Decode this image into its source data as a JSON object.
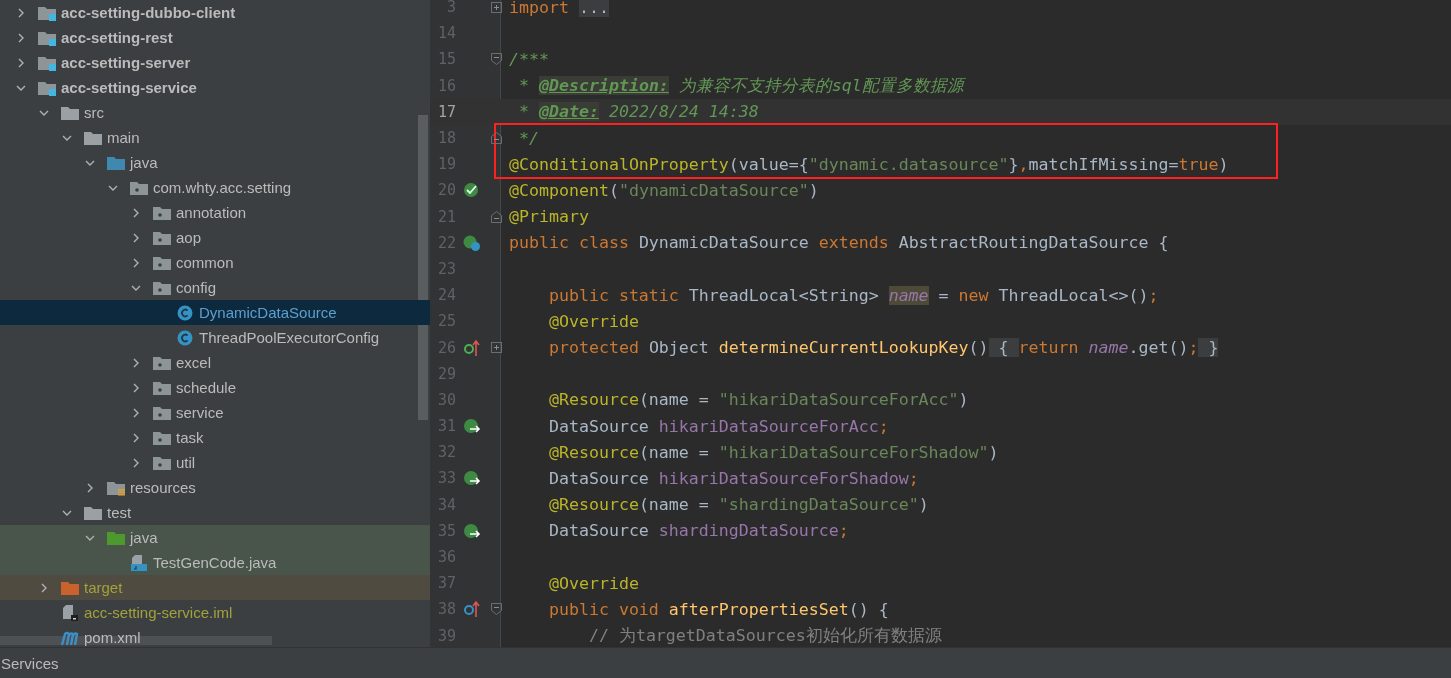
{
  "project_tree": {
    "items": [
      {
        "label": "acc-setting-dubbo-client",
        "kind": "module",
        "expanded": false,
        "selected": false
      },
      {
        "label": "acc-setting-rest",
        "kind": "module",
        "expanded": false,
        "selected": false
      },
      {
        "label": "acc-setting-server",
        "kind": "module",
        "expanded": false,
        "selected": false
      },
      {
        "label": "acc-setting-service",
        "kind": "module",
        "expanded": true,
        "selected": false,
        "children": [
          {
            "label": "src",
            "kind": "folder",
            "expanded": true,
            "selected": false,
            "children": [
              {
                "label": "main",
                "kind": "folder",
                "expanded": true,
                "selected": false,
                "children": [
                  {
                    "label": "java",
                    "kind": "source-root",
                    "expanded": true,
                    "selected": false,
                    "children": [
                      {
                        "label": "com.whty.acc.setting",
                        "kind": "package",
                        "expanded": true,
                        "selected": false,
                        "children": [
                          {
                            "label": "annotation",
                            "kind": "package",
                            "expanded": false,
                            "selected": false
                          },
                          {
                            "label": "aop",
                            "kind": "package",
                            "expanded": false,
                            "selected": false
                          },
                          {
                            "label": "common",
                            "kind": "package",
                            "expanded": false,
                            "selected": false
                          },
                          {
                            "label": "config",
                            "kind": "package",
                            "expanded": true,
                            "selected": false,
                            "children": [
                              {
                                "label": "DynamicDataSource",
                                "kind": "class",
                                "selected": true
                              },
                              {
                                "label": "ThreadPoolExecutorConfig",
                                "kind": "class",
                                "selected": false
                              }
                            ]
                          },
                          {
                            "label": "excel",
                            "kind": "package",
                            "expanded": false,
                            "selected": false
                          },
                          {
                            "label": "schedule",
                            "kind": "package",
                            "expanded": false,
                            "selected": false
                          },
                          {
                            "label": "service",
                            "kind": "package",
                            "expanded": false,
                            "selected": false
                          },
                          {
                            "label": "task",
                            "kind": "package",
                            "expanded": false,
                            "selected": false
                          },
                          {
                            "label": "util",
                            "kind": "package",
                            "expanded": false,
                            "selected": false
                          }
                        ]
                      }
                    ]
                  },
                  {
                    "label": "resources",
                    "kind": "resources-root",
                    "expanded": false,
                    "selected": false
                  }
                ]
              },
              {
                "label": "test",
                "kind": "folder",
                "expanded": true,
                "selected": false,
                "children": [
                  {
                    "label": "java",
                    "kind": "test-root",
                    "expanded": true,
                    "selected": false,
                    "children": [
                      {
                        "label": "TestGenCode.java",
                        "kind": "java-file",
                        "selected": false
                      }
                    ]
                  }
                ]
              }
            ]
          },
          {
            "label": "target",
            "kind": "excluded",
            "expanded": false,
            "selected": false
          },
          {
            "label": "acc-setting-service.iml",
            "kind": "iml",
            "selected": false
          },
          {
            "label": "pom.xml",
            "kind": "maven",
            "selected": false
          }
        ]
      }
    ]
  },
  "editor": {
    "lines": [
      {
        "number": "3",
        "current": false,
        "boxed": false,
        "fold_marker": {
          "kind": "collapsed"
        },
        "tokens": [
          {
            "text": "import ",
            "kind": "keyword"
          },
          {
            "text": "...",
            "kind": "folded"
          }
        ]
      },
      {
        "number": "14",
        "current": false,
        "boxed": false
      },
      {
        "number": "15",
        "current": false,
        "boxed": false,
        "fold_marker": {
          "kind": "start"
        },
        "tokens": [
          {
            "text": "/***",
            "kind": "doc"
          }
        ]
      },
      {
        "number": "16",
        "current": false,
        "boxed": false,
        "tokens": [
          {
            "text": " * ",
            "kind": "doc"
          },
          {
            "text": "@Description:",
            "kind": "doctag"
          },
          {
            "text": " 为兼容不支持分表的sql配置多数据源",
            "kind": "doc"
          }
        ]
      },
      {
        "number": "17",
        "current": true,
        "boxed": false,
        "tokens": [
          {
            "text": " * ",
            "kind": "doc"
          },
          {
            "text": "@Date:",
            "kind": "doctag"
          },
          {
            "text": " 2022/8/24 14:38",
            "kind": "doc"
          }
        ]
      },
      {
        "number": "18",
        "current": false,
        "boxed": true,
        "fold_marker": {
          "kind": "end"
        },
        "tokens": [
          {
            "text": " */",
            "kind": "doc"
          }
        ]
      },
      {
        "number": "19",
        "current": false,
        "boxed": true,
        "tokens": [
          {
            "text": "@ConditionalOnProperty",
            "kind": "annotation"
          },
          {
            "text": "(value={",
            "kind": "plain"
          },
          {
            "text": "\"dynamic.datasource\"",
            "kind": "string"
          },
          {
            "text": "}",
            "kind": "plain"
          },
          {
            "text": ",",
            "kind": "keyword"
          },
          {
            "text": "matchIfMissing=",
            "kind": "plain"
          },
          {
            "text": "true",
            "kind": "keyword"
          },
          {
            "text": ")",
            "kind": "plain"
          }
        ]
      },
      {
        "number": "20",
        "current": false,
        "boxed": false,
        "gutter_icon": {
          "kind": "bean"
        },
        "tokens": [
          {
            "text": "@Component",
            "kind": "annotation"
          },
          {
            "text": "(",
            "kind": "plain"
          },
          {
            "text": "\"dynamicDataSource\"",
            "kind": "string"
          },
          {
            "text": ")",
            "kind": "plain"
          }
        ]
      },
      {
        "number": "21",
        "current": false,
        "boxed": false,
        "fold_marker": {
          "kind": "end"
        },
        "tokens": [
          {
            "text": "@Primary",
            "kind": "annotation"
          }
        ]
      },
      {
        "number": "22",
        "current": false,
        "boxed": false,
        "gutter_icon": {
          "kind": "bean-class"
        },
        "tokens": [
          {
            "text": "public class ",
            "kind": "keyword"
          },
          {
            "text": "DynamicDataSource ",
            "kind": "plain"
          },
          {
            "text": "extends ",
            "kind": "keyword"
          },
          {
            "text": "AbstractRoutingDataSource {",
            "kind": "plain"
          }
        ]
      },
      {
        "number": "23",
        "current": false,
        "boxed": false
      },
      {
        "number": "24",
        "current": false,
        "boxed": false,
        "tokens": [
          {
            "text": "    public static ",
            "kind": "keyword"
          },
          {
            "text": "ThreadLocal<String> ",
            "kind": "plain"
          },
          {
            "text": "name",
            "kind": "field-highlighted"
          },
          {
            "text": " = ",
            "kind": "plain"
          },
          {
            "text": "new ",
            "kind": "keyword"
          },
          {
            "text": "ThreadLocal<>()",
            "kind": "plain"
          },
          {
            "text": ";",
            "kind": "keyword"
          }
        ]
      },
      {
        "number": "25",
        "current": false,
        "boxed": false,
        "tokens": [
          {
            "text": "    @Override",
            "kind": "annotation"
          }
        ]
      },
      {
        "number": "26",
        "current": false,
        "boxed": false,
        "gutter_icon": {
          "kind": "implements"
        },
        "fold_marker": {
          "kind": "collapsed"
        },
        "tokens": [
          {
            "text": "    protected ",
            "kind": "keyword"
          },
          {
            "text": "Object ",
            "kind": "plain"
          },
          {
            "text": "determineCurrentLookupKey",
            "kind": "method"
          },
          {
            "text": "()",
            "kind": "plain"
          },
          {
            "text": " { ",
            "kind": "folded"
          },
          {
            "text": "return ",
            "kind": "keyword"
          },
          {
            "text": "name",
            "kind": "static-field"
          },
          {
            "text": ".get()",
            "kind": "plain"
          },
          {
            "text": ";",
            "kind": "keyword"
          },
          {
            "text": " }",
            "kind": "folded"
          }
        ]
      },
      {
        "number": "29",
        "current": false,
        "boxed": false
      },
      {
        "number": "30",
        "current": false,
        "boxed": false,
        "tokens": [
          {
            "text": "    @Resource",
            "kind": "annotation"
          },
          {
            "text": "(name = ",
            "kind": "plain"
          },
          {
            "text": "\"hikariDataSourceForAcc\"",
            "kind": "string"
          },
          {
            "text": ")",
            "kind": "plain"
          }
        ]
      },
      {
        "number": "31",
        "current": false,
        "boxed": false,
        "gutter_icon": {
          "kind": "inject"
        },
        "tokens": [
          {
            "text": "    DataSource ",
            "kind": "plain"
          },
          {
            "text": "hikariDataSourceForAcc",
            "kind": "field"
          },
          {
            "text": ";",
            "kind": "keyword"
          }
        ]
      },
      {
        "number": "32",
        "current": false,
        "boxed": false,
        "tokens": [
          {
            "text": "    @Resource",
            "kind": "annotation"
          },
          {
            "text": "(name = ",
            "kind": "plain"
          },
          {
            "text": "\"hikariDataSourceForShadow\"",
            "kind": "string"
          },
          {
            "text": ")",
            "kind": "plain"
          }
        ]
      },
      {
        "number": "33",
        "current": false,
        "boxed": false,
        "gutter_icon": {
          "kind": "inject"
        },
        "tokens": [
          {
            "text": "    DataSource ",
            "kind": "plain"
          },
          {
            "text": "hikariDataSourceForShadow",
            "kind": "field"
          },
          {
            "text": ";",
            "kind": "keyword"
          }
        ]
      },
      {
        "number": "34",
        "current": false,
        "boxed": false,
        "tokens": [
          {
            "text": "    @Resource",
            "kind": "annotation"
          },
          {
            "text": "(name = ",
            "kind": "plain"
          },
          {
            "text": "\"shardingDataSource\"",
            "kind": "string"
          },
          {
            "text": ")",
            "kind": "plain"
          }
        ]
      },
      {
        "number": "35",
        "current": false,
        "boxed": false,
        "gutter_icon": {
          "kind": "inject"
        },
        "tokens": [
          {
            "text": "    DataSource ",
            "kind": "plain"
          },
          {
            "text": "shardingDataSource",
            "kind": "field"
          },
          {
            "text": ";",
            "kind": "keyword"
          }
        ]
      },
      {
        "number": "36",
        "current": false,
        "boxed": false
      },
      {
        "number": "37",
        "current": false,
        "boxed": false,
        "tokens": [
          {
            "text": "    @Override",
            "kind": "annotation"
          }
        ]
      },
      {
        "number": "38",
        "current": false,
        "boxed": false,
        "gutter_icon": {
          "kind": "overrides"
        },
        "fold_marker": {
          "kind": "start"
        },
        "tokens": [
          {
            "text": "    public void ",
            "kind": "keyword"
          },
          {
            "text": "afterPropertiesSet",
            "kind": "method"
          },
          {
            "text": "() {",
            "kind": "plain"
          }
        ]
      },
      {
        "number": "39",
        "current": false,
        "boxed": false,
        "tokens": [
          {
            "text": "        // 为targetDataSources初始化所有数据源",
            "kind": "comment"
          }
        ]
      }
    ]
  },
  "bottom_bar": {
    "tool_window": "Services"
  }
}
